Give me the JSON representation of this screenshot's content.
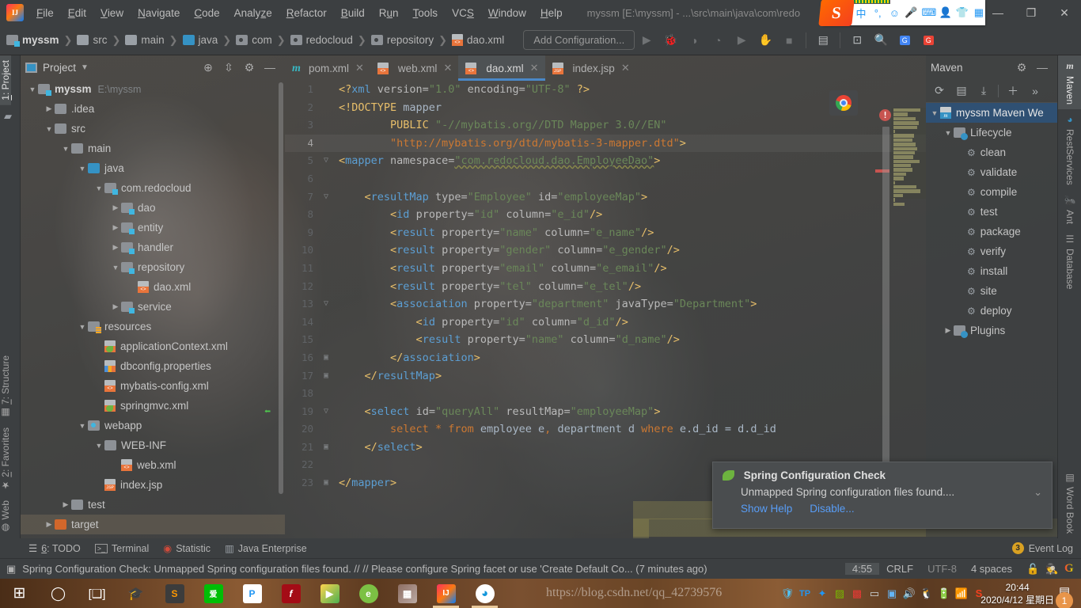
{
  "window": {
    "title": "myssm [E:\\myssm] - ...\\src\\main\\java\\com\\redo",
    "logo_text": "IJ",
    "minimize": "—",
    "restore": "❐",
    "close": "✕"
  },
  "menu": {
    "items": [
      "File",
      "Edit",
      "View",
      "Navigate",
      "Code",
      "Analyze",
      "Refactor",
      "Build",
      "Run",
      "Tools",
      "VCS",
      "Window",
      "Help"
    ]
  },
  "ime": {
    "lang": "中",
    "punct": "°,",
    "emoji": "☺",
    "mic": "🎤",
    "keyboard": "⌨",
    "user": "👤",
    "skin": "👕",
    "apps": "▦"
  },
  "breadcrumbs": [
    {
      "label": "myssm",
      "icon": "module-icon",
      "bold": true
    },
    {
      "label": "src",
      "icon": "folder-icon",
      "bold": false
    },
    {
      "label": "main",
      "icon": "folder-icon",
      "bold": false
    },
    {
      "label": "java",
      "icon": "source-folder-icon",
      "bold": false
    },
    {
      "label": "com",
      "icon": "package-icon",
      "bold": false
    },
    {
      "label": "redocloud",
      "icon": "package-icon",
      "bold": false
    },
    {
      "label": "repository",
      "icon": "package-icon",
      "bold": false
    },
    {
      "label": "dao.xml",
      "icon": "xml-file-icon",
      "bold": false
    }
  ],
  "toolbar": {
    "add_configuration": "Add Configuration..."
  },
  "left_strip": {
    "top": [
      {
        "label": "1: Project",
        "selected": true
      }
    ],
    "bottom": [
      {
        "label": "7: Structure",
        "selected": false
      },
      {
        "label": "2: Favorites",
        "selected": false
      },
      {
        "label": "Web",
        "selected": false
      }
    ]
  },
  "project_panel": {
    "title": "Project",
    "tree": [
      {
        "depth": 0,
        "arrow": "▼",
        "icon": "module-icon",
        "label": "myssm",
        "path": "E:\\myssm",
        "bold": true
      },
      {
        "depth": 1,
        "arrow": "▶",
        "icon": "folder-icon",
        "label": ".idea"
      },
      {
        "depth": 1,
        "arrow": "▼",
        "icon": "folder-icon",
        "label": "src"
      },
      {
        "depth": 2,
        "arrow": "▼",
        "icon": "folder-icon",
        "label": "main"
      },
      {
        "depth": 3,
        "arrow": "▼",
        "icon": "source-folder-icon",
        "label": "java"
      },
      {
        "depth": 4,
        "arrow": "▼",
        "icon": "package-icon",
        "label": "com.redocloud"
      },
      {
        "depth": 5,
        "arrow": "▶",
        "icon": "package-icon",
        "label": "dao"
      },
      {
        "depth": 5,
        "arrow": "▶",
        "icon": "package-icon",
        "label": "entity"
      },
      {
        "depth": 5,
        "arrow": "▶",
        "icon": "package-icon",
        "label": "handler"
      },
      {
        "depth": 5,
        "arrow": "▼",
        "icon": "package-icon",
        "label": "repository"
      },
      {
        "depth": 6,
        "arrow": "",
        "icon": "xml-file-icon",
        "label": "dao.xml"
      },
      {
        "depth": 5,
        "arrow": "▶",
        "icon": "package-icon",
        "label": "service"
      },
      {
        "depth": 3,
        "arrow": "▼",
        "icon": "resources-folder-icon",
        "label": "resources"
      },
      {
        "depth": 4,
        "arrow": "",
        "icon": "spring-xml-icon",
        "label": "applicationContext.xml"
      },
      {
        "depth": 4,
        "arrow": "",
        "icon": "properties-file-icon",
        "label": "dbconfig.properties"
      },
      {
        "depth": 4,
        "arrow": "",
        "icon": "xml-file-icon",
        "label": "mybatis-config.xml"
      },
      {
        "depth": 4,
        "arrow": "",
        "icon": "spring-xml-icon",
        "label": "springmvc.xml"
      },
      {
        "depth": 3,
        "arrow": "▼",
        "icon": "web-folder-icon",
        "label": "webapp"
      },
      {
        "depth": 4,
        "arrow": "▼",
        "icon": "folder-icon",
        "label": "WEB-INF"
      },
      {
        "depth": 5,
        "arrow": "",
        "icon": "xml-file-icon",
        "label": "web.xml"
      },
      {
        "depth": 4,
        "arrow": "",
        "icon": "jsp-file-icon",
        "label": "index.jsp"
      },
      {
        "depth": 2,
        "arrow": "▶",
        "icon": "folder-icon",
        "label": "test"
      },
      {
        "depth": 1,
        "arrow": "▶",
        "icon": "target-folder-icon",
        "label": "target",
        "selected": true
      }
    ]
  },
  "editor": {
    "tabs": [
      {
        "label": "pom.xml",
        "icon": "maven-icon",
        "active": false
      },
      {
        "label": "web.xml",
        "icon": "xml-file-icon",
        "active": false
      },
      {
        "label": "dao.xml",
        "icon": "xml-file-icon",
        "active": true
      },
      {
        "label": "index.jsp",
        "icon": "jsp-file-icon",
        "active": false
      }
    ],
    "close_glyph": "✕",
    "error_count": "!",
    "lines": [
      {
        "n": "1",
        "fold": "",
        "html": "<span class=\"t\">&lt;?</span><span class=\"tn\">xml </span><span class=\"at\">version=</span><span class=\"st\">\"1.0\"</span><span class=\"at\"> encoding=</span><span class=\"st\">\"UTF-8\"</span> <span class=\"t\">?&gt;</span>"
      },
      {
        "n": "2",
        "fold": "",
        "html": "<span class=\"t\">&lt;!DOCTYPE</span><span class=\"va\"> mapper</span>"
      },
      {
        "n": "3",
        "fold": "",
        "html": "        <span class=\"t\">PUBLIC</span> <span class=\"st\">\"-//mybatis.org//DTD Mapper 3.0//EN\"</span>"
      },
      {
        "n": "4",
        "fold": "",
        "html": "        <span class=\"url\">\"http://mybatis.org/dtd/mybatis-3-mapper.dtd\"</span><span class=\"t\">&gt;</span>",
        "current": true
      },
      {
        "n": "5",
        "fold": "▽",
        "html": "<span class=\"t\">&lt;</span><span class=\"tn\">mapper </span><span class=\"at\">namespace=</span><span class=\"st err-sq\">\"com.redocloud.dao.EmployeeDao\"</span><span class=\"t\">&gt;</span>"
      },
      {
        "n": "6",
        "fold": "",
        "html": ""
      },
      {
        "n": "7",
        "fold": "▽",
        "html": "    <span class=\"t\">&lt;</span><span class=\"tn\">resultMap </span><span class=\"at\">type=</span><span class=\"st\">\"Employee\"</span><span class=\"at\"> id=</span><span class=\"st\">\"employeeMap\"</span><span class=\"t\">&gt;</span>"
      },
      {
        "n": "8",
        "fold": "",
        "html": "        <span class=\"t\">&lt;</span><span class=\"tn\">id </span><span class=\"at\">property=</span><span class=\"st\">\"id\"</span><span class=\"at\"> column=</span><span class=\"st\">\"e_id\"</span><span class=\"t\">/&gt;</span>"
      },
      {
        "n": "9",
        "fold": "",
        "html": "        <span class=\"t\">&lt;</span><span class=\"tn\">result </span><span class=\"at\">property=</span><span class=\"st\">\"name\"</span><span class=\"at\"> column=</span><span class=\"st\">\"e_name\"</span><span class=\"t\">/&gt;</span>"
      },
      {
        "n": "10",
        "fold": "",
        "html": "        <span class=\"t\">&lt;</span><span class=\"tn\">result </span><span class=\"at\">property=</span><span class=\"st\">\"gender\"</span><span class=\"at\"> column=</span><span class=\"st\">\"e_gender\"</span><span class=\"t\">/&gt;</span>"
      },
      {
        "n": "11",
        "fold": "",
        "html": "        <span class=\"t\">&lt;</span><span class=\"tn\">result </span><span class=\"at\">property=</span><span class=\"st\">\"email\"</span><span class=\"at\"> column=</span><span class=\"st\">\"e_email\"</span><span class=\"t\">/&gt;</span>"
      },
      {
        "n": "12",
        "fold": "",
        "html": "        <span class=\"t\">&lt;</span><span class=\"tn\">result </span><span class=\"at\">property=</span><span class=\"st\">\"tel\"</span><span class=\"at\"> column=</span><span class=\"st\">\"e_tel\"</span><span class=\"t\">/&gt;</span>"
      },
      {
        "n": "13",
        "fold": "▽",
        "html": "        <span class=\"t\">&lt;</span><span class=\"tn\">association </span><span class=\"at\">property=</span><span class=\"st\">\"department\"</span><span class=\"at\"> javaType=</span><span class=\"st\">\"Department\"</span><span class=\"t\">&gt;</span>"
      },
      {
        "n": "14",
        "fold": "",
        "html": "            <span class=\"t\">&lt;</span><span class=\"tn\">id </span><span class=\"at\">property=</span><span class=\"st\">\"id\"</span><span class=\"at\"> column=</span><span class=\"st\">\"d_id\"</span><span class=\"t\">/&gt;</span>"
      },
      {
        "n": "15",
        "fold": "",
        "html": "            <span class=\"t\">&lt;</span><span class=\"tn\">result </span><span class=\"at\">property=</span><span class=\"st\">\"name\"</span><span class=\"at\"> column=</span><span class=\"st\">\"d_name\"</span><span class=\"t\">/&gt;</span>"
      },
      {
        "n": "16",
        "fold": "▣",
        "html": "        <span class=\"t\">&lt;/</span><span class=\"tn\">association</span><span class=\"t\">&gt;</span>"
      },
      {
        "n": "17",
        "fold": "▣",
        "html": "    <span class=\"t\">&lt;/</span><span class=\"tn\">resultMap</span><span class=\"t\">&gt;</span>"
      },
      {
        "n": "18",
        "fold": "",
        "html": ""
      },
      {
        "n": "19",
        "fold": "▽",
        "html": "    <span class=\"t\">&lt;</span><span class=\"tn\">select </span><span class=\"at\">id=</span><span class=\"st\">\"queryAll\"</span><span class=\"at\"> resultMap=</span><span class=\"st\">\"employeeMap\"</span><span class=\"t\">&gt;</span>",
        "back_arrow": true
      },
      {
        "n": "20",
        "fold": "",
        "html": "        <span class=\"sqk\">select</span> <span class=\"sqk\">*</span> <span class=\"sqk\">from</span> <span class=\"va\">employee e</span><span class=\"sqk\">,</span> <span class=\"va\">department d</span> <span class=\"sqk\">where</span> <span class=\"va\">e.d_id = d.d_id</span>"
      },
      {
        "n": "21",
        "fold": "▣",
        "html": "    <span class=\"t\">&lt;/</span><span class=\"tn\">select</span><span class=\"t\">&gt;</span>"
      },
      {
        "n": "22",
        "fold": "",
        "html": ""
      },
      {
        "n": "23",
        "fold": "▣",
        "html": "<span class=\"t\">&lt;/</span><span class=\"tn\">mapper</span><span class=\"t\">&gt;</span>"
      }
    ],
    "browser_icon": "chrome-icon"
  },
  "maven_panel": {
    "title": "Maven",
    "toolbar_icons": [
      "refresh-icon",
      "add-maven-project-icon",
      "download-sources-icon",
      "plus-icon",
      "more-icon"
    ],
    "tree": [
      {
        "depth": 0,
        "arrow": "▼",
        "icon": "maven-project-icon",
        "label": "myssm Maven We",
        "selected": true
      },
      {
        "depth": 1,
        "arrow": "▼",
        "icon": "lifecycle-folder-icon",
        "label": "Lifecycle"
      },
      {
        "depth": 2,
        "arrow": "",
        "icon": "goal-icon",
        "label": "clean"
      },
      {
        "depth": 2,
        "arrow": "",
        "icon": "goal-icon",
        "label": "validate"
      },
      {
        "depth": 2,
        "arrow": "",
        "icon": "goal-icon",
        "label": "compile"
      },
      {
        "depth": 2,
        "arrow": "",
        "icon": "goal-icon",
        "label": "test"
      },
      {
        "depth": 2,
        "arrow": "",
        "icon": "goal-icon",
        "label": "package"
      },
      {
        "depth": 2,
        "arrow": "",
        "icon": "goal-icon",
        "label": "verify"
      },
      {
        "depth": 2,
        "arrow": "",
        "icon": "goal-icon",
        "label": "install"
      },
      {
        "depth": 2,
        "arrow": "",
        "icon": "goal-icon",
        "label": "site"
      },
      {
        "depth": 2,
        "arrow": "",
        "icon": "goal-icon",
        "label": "deploy"
      },
      {
        "depth": 1,
        "arrow": "▶",
        "icon": "plugins-folder-icon",
        "label": "Plugins"
      }
    ]
  },
  "right_strip": {
    "top": [
      {
        "label": "Maven",
        "selected": true,
        "icon": "maven-icon"
      },
      {
        "label": "RestServices",
        "selected": false,
        "icon": "rest-icon"
      },
      {
        "label": "Ant",
        "selected": false,
        "icon": "ant-icon"
      },
      {
        "label": "Database",
        "selected": false,
        "icon": "database-icon"
      }
    ],
    "bottom": [
      {
        "label": "Word Book",
        "selected": false,
        "icon": "book-icon"
      }
    ]
  },
  "notification": {
    "title": "Spring Configuration Check",
    "body": "Unmapped Spring configuration files found....",
    "links": [
      "Show Help",
      "Disable..."
    ],
    "collapse_glyph": "⌄",
    "icon": "spring-leaf-icon"
  },
  "bottom_bar": {
    "items": [
      {
        "label": "6: TODO",
        "icon": "todo-icon"
      },
      {
        "label": "Terminal",
        "icon": "terminal-icon"
      },
      {
        "label": "Statistic",
        "icon": "statistic-icon"
      },
      {
        "label": "Java Enterprise",
        "icon": "java-enterprise-icon"
      }
    ],
    "event_log": "Event Log",
    "event_count": "3"
  },
  "status_bar": {
    "message": "Spring Configuration Check: Unmapped Spring configuration files found. // // Please configure Spring facet or use 'Create Default Co... (7 minutes ago)",
    "time": "4:55",
    "line_separator": "CRLF",
    "encoding": "UTF-8",
    "indent": "4 spaces",
    "lock_icon": "unlock-icon",
    "inspector_icon": "hector-icon",
    "google_icon": "google-icon"
  },
  "taskbar": {
    "items": [
      {
        "name": "start-button",
        "glyph": "⊞"
      },
      {
        "name": "cortana-search",
        "glyph": "◯"
      },
      {
        "name": "task-view",
        "glyph": "❑"
      },
      {
        "name": "wps-office",
        "glyph": "W"
      },
      {
        "name": "sublime-text",
        "glyph": "S"
      },
      {
        "name": "iqiyi",
        "glyph": "爱"
      },
      {
        "name": "pp-video",
        "glyph": "P"
      },
      {
        "name": "flash-player",
        "glyph": "f"
      },
      {
        "name": "potplayer",
        "glyph": "▶"
      },
      {
        "name": "360-browser",
        "glyph": "e"
      },
      {
        "name": "photo-viewer",
        "glyph": "▦"
      },
      {
        "name": "intellij-idea",
        "glyph": "IJ"
      },
      {
        "name": "qq-browser",
        "glyph": "Q"
      }
    ],
    "tray": [
      "shield-icon",
      "tp-icon",
      "bluetooth-icon",
      "nvidia-icon",
      "security-icon",
      "display-icon",
      "drive-icon",
      "volume-icon",
      "qq-icon",
      "battery-icon",
      "wifi-icon"
    ],
    "clock_time": "20:44",
    "clock_date": "2020/4/12 星期日",
    "notification_count": "1"
  },
  "watermark": "https://blog.csdn.net/qq_42739576"
}
